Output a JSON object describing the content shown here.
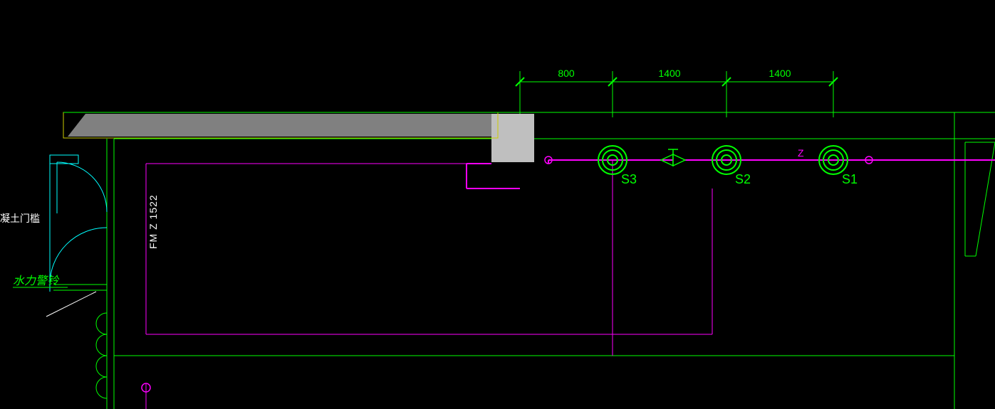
{
  "dimensions": {
    "d1": "800",
    "d2": "1400",
    "d3": "1400"
  },
  "sensors": {
    "s1": "S1",
    "s2": "S2",
    "s3": "S3"
  },
  "pipe_label": "Z",
  "door_code": "FM Z 1522",
  "note_left": "凝土门槛",
  "water_alarm": "水力警铃"
}
